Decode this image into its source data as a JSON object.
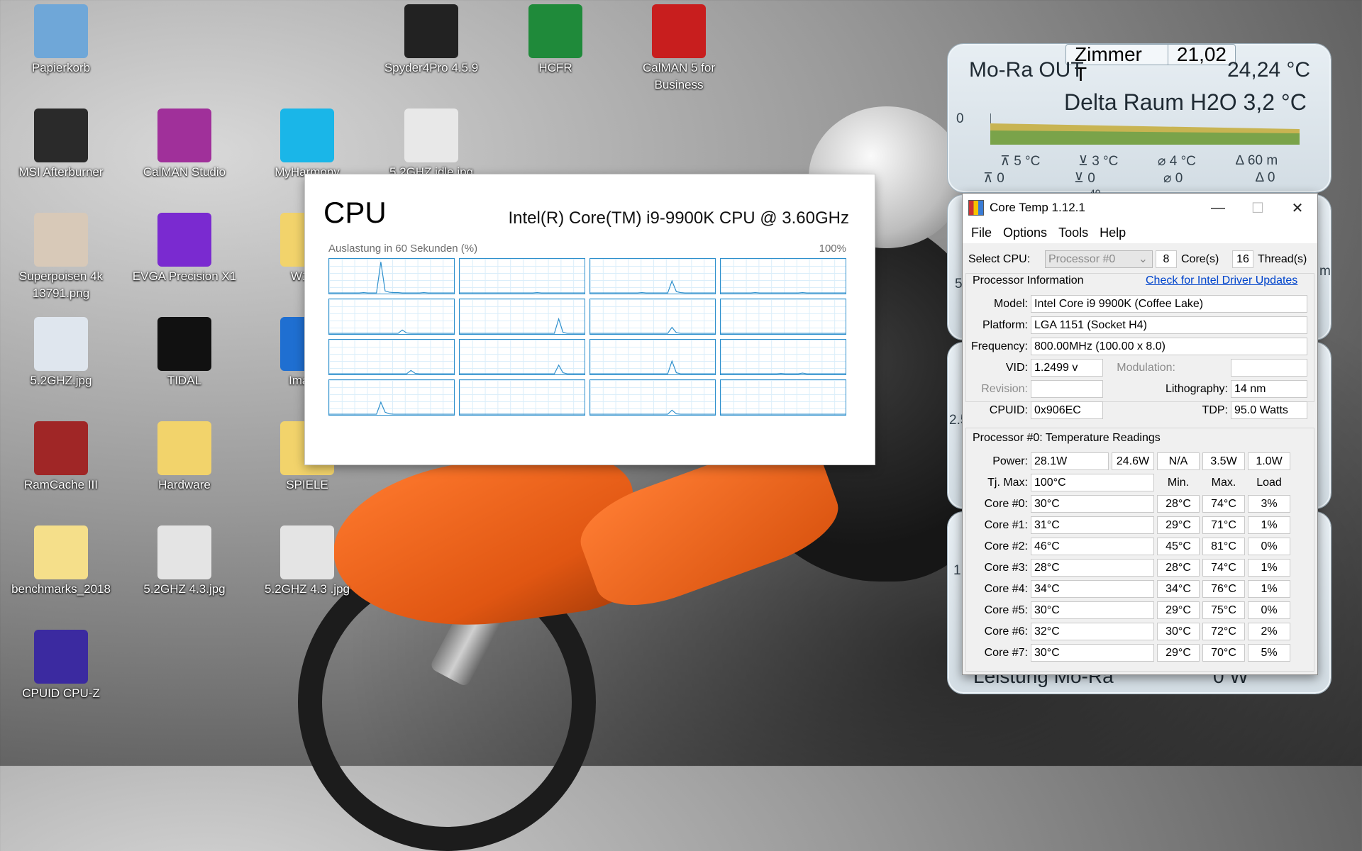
{
  "desktop": {
    "icons": [
      {
        "label": "Papierkorb",
        "icon": "recycle-bin-icon",
        "color": "#6fa7d8"
      },
      {
        "label": "Spyder4Pro 4.5.9",
        "icon": "spyder-icon",
        "color": "#222222"
      },
      {
        "label": "HCFR",
        "icon": "hcfr-icon",
        "color": "#1f8a3a"
      },
      {
        "label": "CalMAN 5 for Business",
        "icon": "calman5-icon",
        "color": "#c81e1e"
      },
      {
        "label": "MSI Afterburner",
        "icon": "afterburner-icon",
        "color": "#2a2a2a"
      },
      {
        "label": "CalMAN Studio",
        "icon": "calman-studio-icon",
        "color": "#a0309a"
      },
      {
        "label": "MyHarmony",
        "icon": "harmony-icon",
        "color": "#1ab6e8"
      },
      {
        "label": "5.2GHZ idle.jpg",
        "icon": "image-file-icon",
        "color": "#e8e8e8"
      },
      {
        "label": "Superpoisen 4k 13791.png",
        "icon": "image-file-icon",
        "color": "#d8c9b8"
      },
      {
        "label": "EVGA Precision X1",
        "icon": "precision-x1-icon",
        "color": "#7a2ad0"
      },
      {
        "label": "W10P",
        "icon": "folder-icon",
        "color": "#f2d36b"
      },
      {
        "label": "5.2GHZ.jpg",
        "icon": "image-file-icon",
        "color": "#dfe6ee"
      },
      {
        "label": "TIDAL",
        "icon": "tidal-icon",
        "color": "#111111"
      },
      {
        "label": "ImageI",
        "icon": "imageglass-icon",
        "color": "#1f6fd1"
      },
      {
        "label": "RamCache III",
        "icon": "ramcache-icon",
        "color": "#a02626"
      },
      {
        "label": "Hardware",
        "icon": "hardware-folder-icon",
        "color": "#f2d36b"
      },
      {
        "label": "SPIELE",
        "icon": "folder-icon",
        "color": "#f2d36b"
      },
      {
        "label": "benchmarks_2018",
        "icon": "folder-icon",
        "color": "#f5df8a"
      },
      {
        "label": "5.2GHZ 4.3.jpg",
        "icon": "image-file-icon",
        "color": "#e4e4e4"
      },
      {
        "label": "5.2GHZ 4.3 .jpg",
        "icon": "image-file-icon",
        "color": "#e4e4e4"
      },
      {
        "label": "CPUID CPU-Z",
        "icon": "cpuz-icon",
        "color": "#3b2aa0"
      }
    ]
  },
  "cpu_window": {
    "title": "CPU",
    "model": "Intel(R) Core(TM) i9-9900K CPU @ 3.60GHz",
    "caption": "Auslastung in 60 Sekunden (%)",
    "max_label": "100%",
    "graph_color": "#2d8fcc"
  },
  "chart_data": {
    "type": "line",
    "title": "Auslastung in 60 Sekunden (%)",
    "ylim": [
      0,
      100
    ],
    "series": [
      {
        "values": [
          2,
          2,
          2,
          2,
          2,
          2,
          2,
          2,
          3,
          2,
          2,
          2,
          95,
          8,
          4,
          3,
          3,
          2,
          2,
          2,
          2,
          2,
          3,
          2,
          2,
          2,
          2,
          2,
          2,
          2
        ]
      },
      {
        "values": [
          2,
          2,
          2,
          2,
          2,
          2,
          2,
          2,
          2,
          2,
          2,
          2,
          2,
          2,
          2,
          2,
          2,
          2,
          3,
          2,
          2,
          2,
          2,
          2,
          2,
          2,
          2,
          2,
          2,
          2
        ]
      },
      {
        "values": [
          2,
          2,
          2,
          2,
          2,
          2,
          2,
          2,
          2,
          2,
          2,
          2,
          3,
          2,
          2,
          2,
          2,
          2,
          2,
          38,
          6,
          3,
          2,
          2,
          2,
          2,
          2,
          2,
          2,
          2
        ]
      },
      {
        "values": [
          2,
          2,
          2,
          2,
          2,
          2,
          2,
          2,
          3,
          2,
          2,
          2,
          2,
          2,
          2,
          2,
          2,
          2,
          2,
          3,
          2,
          2,
          2,
          2,
          2,
          2,
          2,
          2,
          2,
          2
        ]
      },
      {
        "values": [
          2,
          2,
          2,
          2,
          2,
          2,
          2,
          2,
          2,
          2,
          2,
          2,
          2,
          2,
          2,
          2,
          2,
          12,
          3,
          2,
          2,
          2,
          2,
          2,
          2,
          2,
          2,
          2,
          2,
          2
        ]
      },
      {
        "values": [
          2,
          2,
          2,
          2,
          2,
          2,
          2,
          2,
          2,
          2,
          2,
          2,
          2,
          2,
          2,
          2,
          2,
          2,
          2,
          2,
          2,
          2,
          2,
          45,
          5,
          2,
          2,
          2,
          2,
          2
        ]
      },
      {
        "values": [
          2,
          2,
          2,
          2,
          2,
          2,
          2,
          2,
          2,
          2,
          2,
          2,
          2,
          2,
          2,
          2,
          2,
          2,
          2,
          20,
          4,
          2,
          2,
          2,
          2,
          2,
          2,
          2,
          2,
          2
        ]
      },
      {
        "values": [
          2,
          2,
          2,
          2,
          2,
          2,
          2,
          2,
          2,
          2,
          2,
          2,
          2,
          2,
          2,
          2,
          2,
          2,
          2,
          2,
          2,
          2,
          2,
          2,
          2,
          2,
          2,
          2,
          2,
          2
        ]
      },
      {
        "values": [
          2,
          2,
          2,
          2,
          2,
          2,
          2,
          2,
          2,
          2,
          2,
          2,
          2,
          2,
          2,
          2,
          2,
          2,
          2,
          12,
          3,
          2,
          2,
          2,
          2,
          2,
          2,
          2,
          2,
          2
        ]
      },
      {
        "values": [
          2,
          2,
          2,
          2,
          2,
          2,
          2,
          2,
          2,
          2,
          2,
          2,
          2,
          2,
          2,
          2,
          2,
          2,
          2,
          2,
          2,
          2,
          2,
          28,
          5,
          2,
          2,
          2,
          2,
          2
        ]
      },
      {
        "values": [
          2,
          2,
          2,
          2,
          2,
          2,
          2,
          2,
          2,
          2,
          2,
          2,
          2,
          2,
          2,
          2,
          2,
          2,
          2,
          40,
          5,
          2,
          2,
          2,
          2,
          2,
          2,
          2,
          2,
          2
        ]
      },
      {
        "values": [
          2,
          2,
          2,
          2,
          2,
          2,
          2,
          2,
          2,
          2,
          2,
          2,
          2,
          2,
          3,
          2,
          2,
          2,
          2,
          4,
          2,
          2,
          2,
          2,
          2,
          2,
          2,
          2,
          2,
          2
        ]
      },
      {
        "values": [
          2,
          2,
          2,
          2,
          2,
          2,
          2,
          2,
          2,
          2,
          2,
          2,
          38,
          8,
          3,
          2,
          2,
          2,
          2,
          2,
          2,
          2,
          2,
          2,
          2,
          2,
          2,
          2,
          2,
          2
        ]
      },
      {
        "values": [
          2,
          2,
          2,
          2,
          2,
          2,
          2,
          2,
          2,
          2,
          2,
          2,
          2,
          2,
          2,
          2,
          2,
          2,
          2,
          2,
          2,
          2,
          2,
          2,
          2,
          2,
          2,
          2,
          2,
          2
        ]
      },
      {
        "values": [
          2,
          2,
          2,
          2,
          2,
          2,
          2,
          2,
          2,
          2,
          2,
          2,
          2,
          2,
          2,
          2,
          2,
          2,
          2,
          14,
          3,
          2,
          2,
          2,
          2,
          2,
          2,
          2,
          2,
          2
        ]
      },
      {
        "values": [
          2,
          2,
          2,
          2,
          2,
          2,
          2,
          2,
          2,
          2,
          2,
          2,
          2,
          2,
          2,
          2,
          2,
          2,
          2,
          2,
          2,
          2,
          2,
          2,
          2,
          2,
          2,
          2,
          2,
          2
        ]
      }
    ]
  },
  "aquasuite": {
    "tag_label": "Zimmer T",
    "tag_value": "21,02",
    "out_label": "Mo-Ra OUT",
    "out_value": "24,24 °C",
    "delta_label": "Delta Raum H2O 3,2 °C",
    "axis_zero": "0",
    "stats_top": [
      "5 °C",
      "3 °C",
      "4 °C",
      "60 m"
    ],
    "stats_bottom": [
      "0",
      "0",
      "0",
      "0"
    ],
    "footer_label": "Leistung Mo-Ra",
    "footer_value": "0 W",
    "side_values": [
      "5",
      "2.5",
      "1."
    ],
    "stray_value": "40",
    "stray_unit": "m",
    "graph_colors": [
      "#c8b452",
      "#7aa34a"
    ]
  },
  "coretemp": {
    "title": "Core Temp 1.12.1",
    "menu": [
      "File",
      "Options",
      "Tools",
      "Help"
    ],
    "select_cpu_label": "Select CPU:",
    "processor_option": "Processor #0",
    "cores_value": "8",
    "cores_label": "Core(s)",
    "threads_value": "16",
    "threads_label": "Thread(s)",
    "proc_info_title": "Processor Information",
    "driver_link": "Check for Intel Driver Updates",
    "model_label": "Model:",
    "model_value": "Intel Core i9 9900K (Coffee Lake)",
    "platform_label": "Platform:",
    "platform_value": "LGA 1151 (Socket H4)",
    "frequency_label": "Frequency:",
    "frequency_value": "800.00MHz (100.00 x 8.0)",
    "vid_label": "VID:",
    "vid_value": "1.2499 v",
    "modulation_label": "Modulation:",
    "revision_label": "Revision:",
    "lithography_label": "Lithography:",
    "lithography_value": "14 nm",
    "cpuid_label": "CPUID:",
    "cpuid_value": "0x906EC",
    "tdp_label": "TDP:",
    "tdp_value": "95.0 Watts",
    "temp_title": "Processor #0: Temperature Readings",
    "power_label": "Power:",
    "power_values": [
      "28.1W",
      "24.6W",
      "N/A",
      "3.5W",
      "1.0W"
    ],
    "tjmax_label": "Tj. Max:",
    "tjmax_value": "100°C",
    "col_min": "Min.",
    "col_max": "Max.",
    "col_load": "Load",
    "cores": [
      {
        "label": "Core #0:",
        "temp": "30°C",
        "min": "28°C",
        "max": "74°C",
        "load": "3%"
      },
      {
        "label": "Core #1:",
        "temp": "31°C",
        "min": "29°C",
        "max": "71°C",
        "load": "1%"
      },
      {
        "label": "Core #2:",
        "temp": "46°C",
        "min": "45°C",
        "max": "81°C",
        "load": "0%"
      },
      {
        "label": "Core #3:",
        "temp": "28°C",
        "min": "28°C",
        "max": "74°C",
        "load": "1%"
      },
      {
        "label": "Core #4:",
        "temp": "34°C",
        "min": "34°C",
        "max": "76°C",
        "load": "1%"
      },
      {
        "label": "Core #5:",
        "temp": "30°C",
        "min": "29°C",
        "max": "75°C",
        "load": "0%"
      },
      {
        "label": "Core #6:",
        "temp": "32°C",
        "min": "30°C",
        "max": "72°C",
        "load": "2%"
      },
      {
        "label": "Core #7:",
        "temp": "30°C",
        "min": "29°C",
        "max": "70°C",
        "load": "5%"
      }
    ]
  }
}
